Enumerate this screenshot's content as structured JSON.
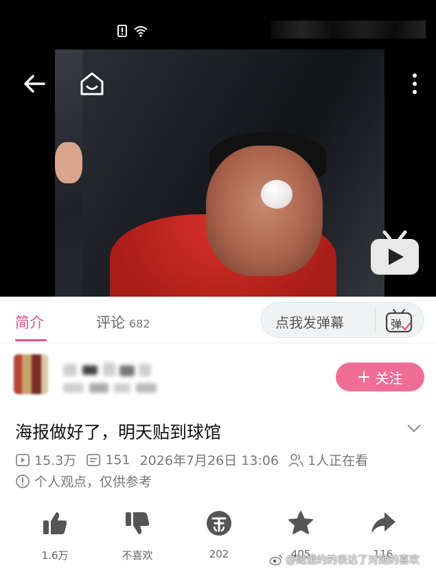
{
  "tabs": {
    "intro": "简介",
    "comments": "评论",
    "comments_count": "682"
  },
  "danmaku": {
    "placeholder": "点我发弹幕",
    "icon_label": "弹"
  },
  "uploader": {
    "follow_label": "关注"
  },
  "video": {
    "title": "海报做好了，明天贴到球馆",
    "views": "15.3万",
    "danmaku_count": "151",
    "published": "2026年7月26日 13:06",
    "watching": "1人正在看",
    "disclaimer": "个人观点，仅供参考"
  },
  "actions": {
    "like": "1.6万",
    "dislike": "不喜欢",
    "coin": "202",
    "favorite": "405",
    "share": "116"
  },
  "watermark": "@贼饿约的表达了对她的喜欢",
  "colors": {
    "accent": "#e7507f",
    "follow_bg": "#ef6d97"
  },
  "icons": {
    "back": "arrow-left-icon",
    "home": "home-tv-icon",
    "more": "more-vertical-icon",
    "player": "bilibili-tv-play-icon",
    "views": "play-count-icon",
    "danmaku": "danmaku-count-icon",
    "watching": "viewers-icon",
    "disclaimer": "info-icon",
    "like": "thumbs-up-icon",
    "dislike": "thumbs-down-icon",
    "coin": "coin-icon",
    "favorite": "star-icon",
    "share": "share-icon"
  }
}
